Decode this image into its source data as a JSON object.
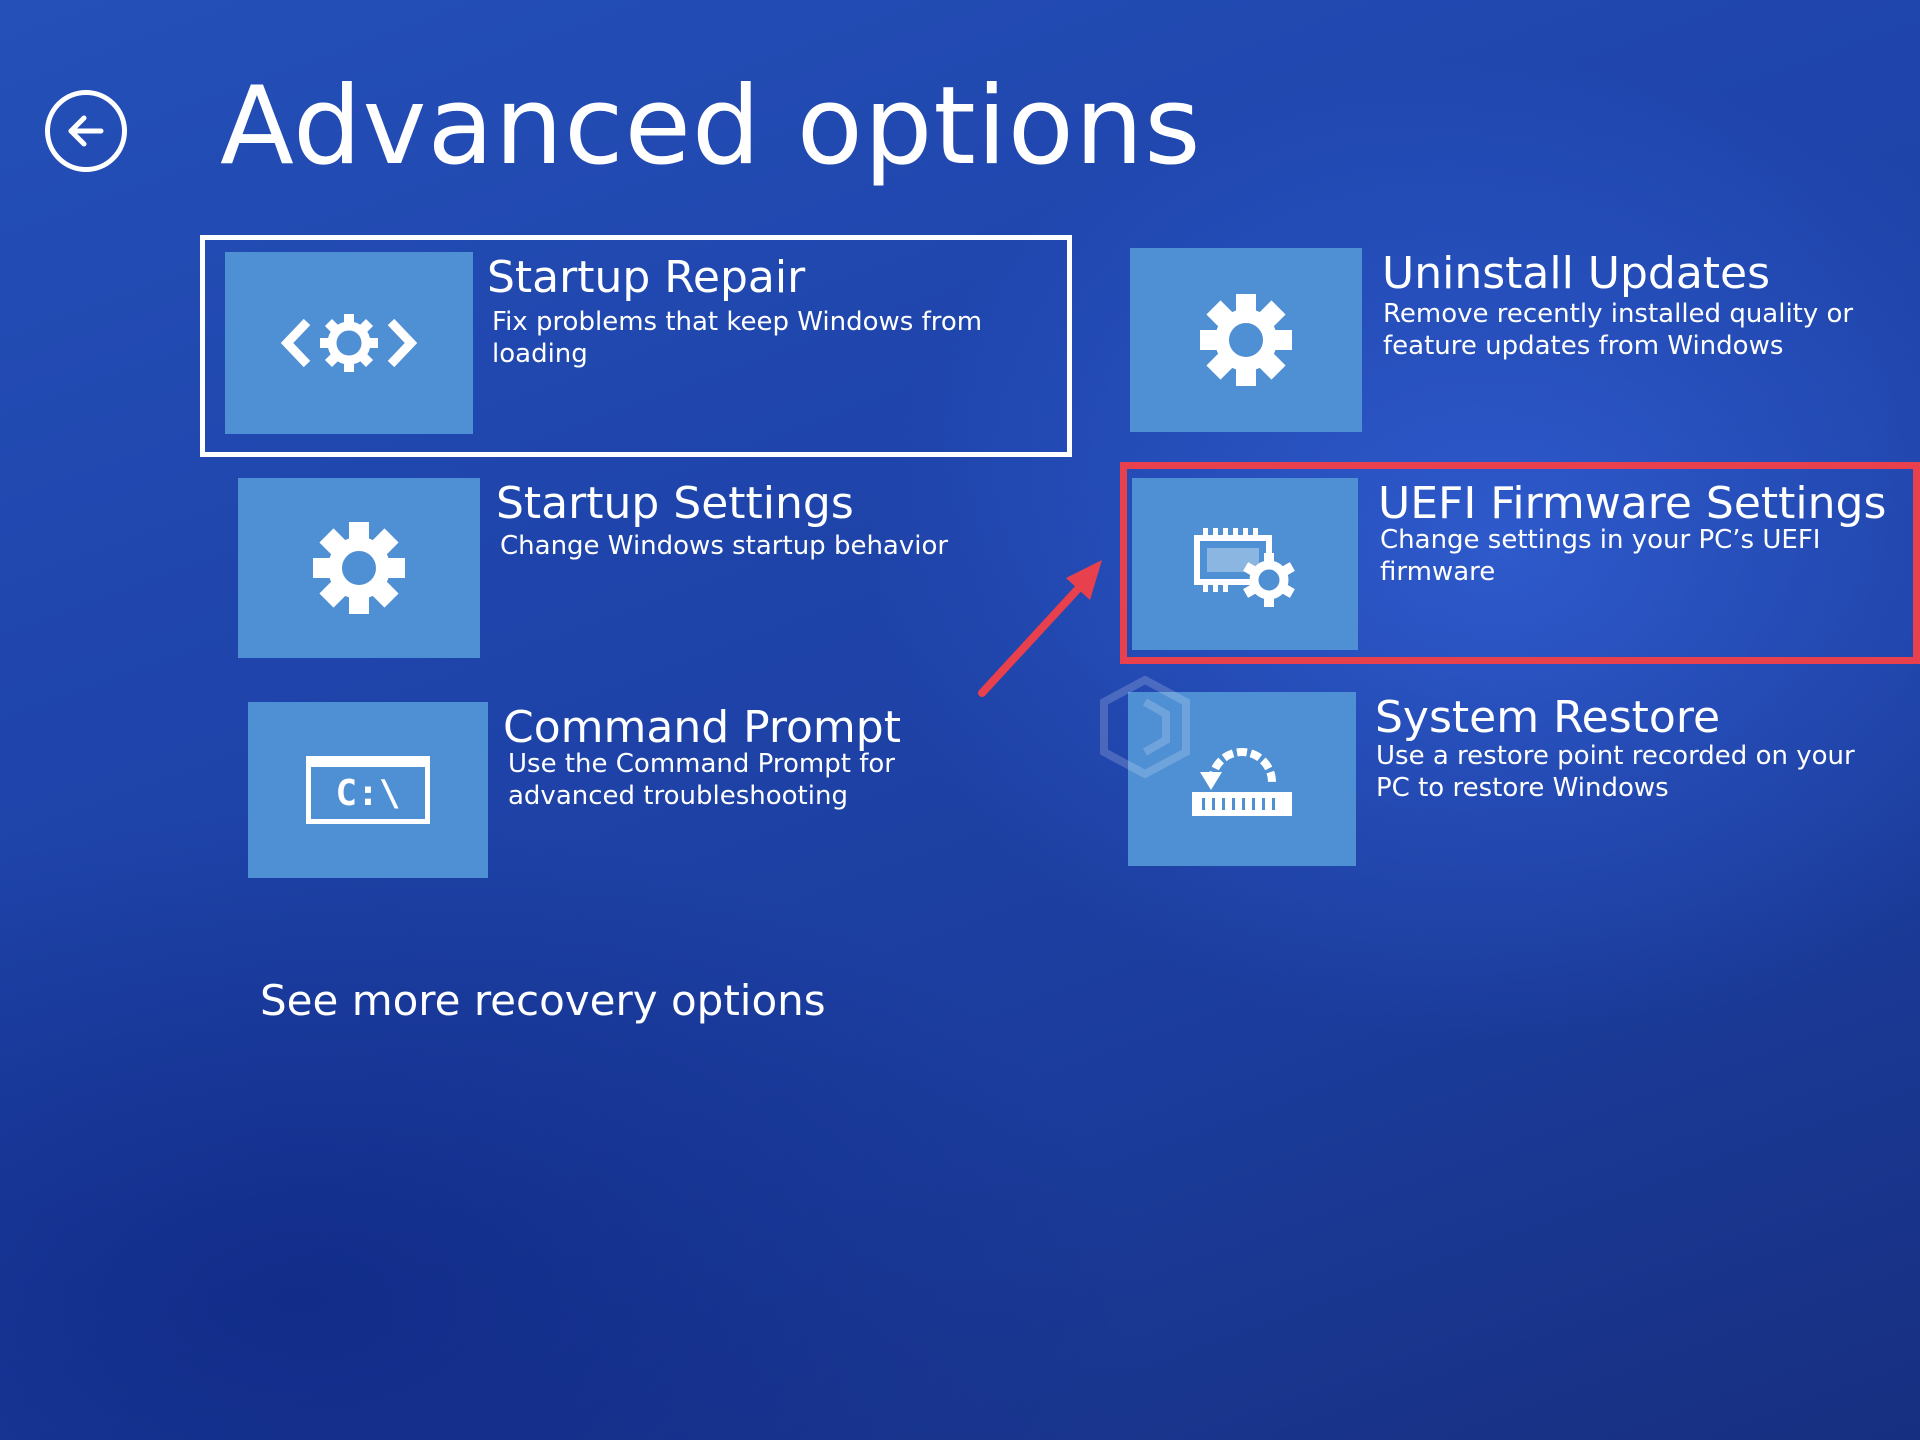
{
  "page": {
    "title": "Advanced options",
    "back_label": "Back"
  },
  "options": [
    {
      "title": "Startup Repair",
      "description": "Fix problems that keep Windows from loading",
      "icon": "startup-repair-icon"
    },
    {
      "title": "Uninstall Updates",
      "description": "Remove recently installed quality or feature updates from Windows",
      "icon": "gear-icon"
    },
    {
      "title": "Startup Settings",
      "description": "Change Windows startup behavior",
      "icon": "gear-icon"
    },
    {
      "title": "UEFI Firmware Settings",
      "description": "Change settings in your PC’s UEFI firmware",
      "icon": "firmware-chip-gear-icon"
    },
    {
      "title": "Command Prompt",
      "description": "Use the Command Prompt for advanced troubleshooting",
      "icon": "command-prompt-icon",
      "icon_text": "C:\\"
    },
    {
      "title": "System Restore",
      "description": "Use a restore point recorded on your PC to restore Windows",
      "icon": "system-restore-icon"
    }
  ],
  "more_link": "See more recovery options",
  "colors": {
    "background": "#1f45ac",
    "tile": "#4f8fd3",
    "highlight": "#e8404c",
    "text": "#ffffff"
  }
}
